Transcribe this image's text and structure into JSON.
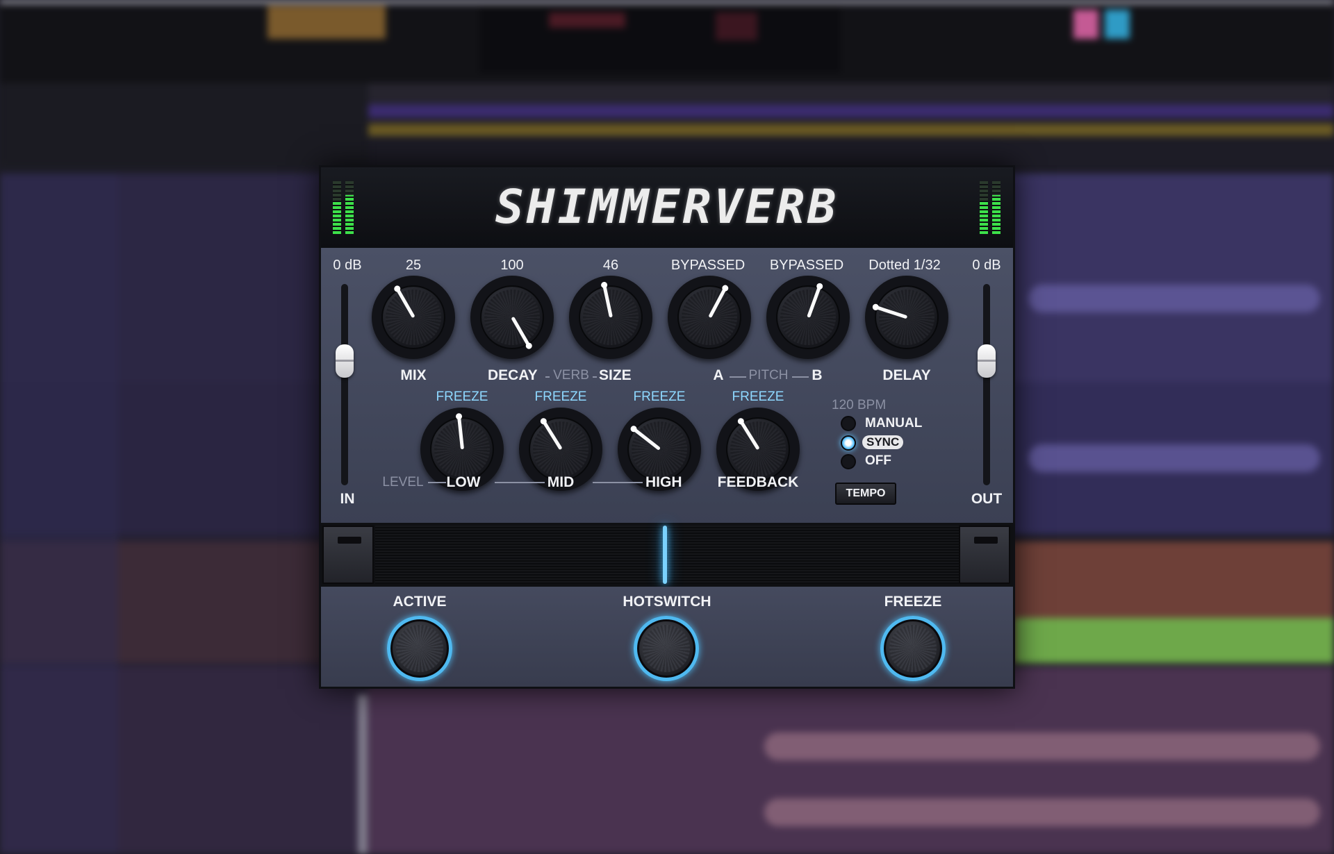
{
  "plugin": {
    "title": "SHIMMERVERB",
    "colors": {
      "accent": "#5fc4ff",
      "meter": "#3de04a",
      "panel": "#42475a"
    }
  },
  "input": {
    "value": "0 dB",
    "label": "IN",
    "level": 0.64
  },
  "output": {
    "value": "0 dB",
    "label": "OUT",
    "level": 0.64
  },
  "knobs_top": [
    {
      "label": "MIX",
      "value": "25"
    },
    {
      "label": "DECAY",
      "value": "100"
    },
    {
      "label": "SIZE",
      "value": "46"
    },
    {
      "label": "A",
      "value": "BYPASSED"
    },
    {
      "label": "B",
      "value": "BYPASSED"
    },
    {
      "label": "DELAY",
      "value": "Dotted 1/32"
    }
  ],
  "groups": {
    "verb": "VERB",
    "pitch": "PITCH",
    "level": "LEVEL"
  },
  "knobs_bottom": [
    {
      "label": "LOW",
      "value": "FREEZE"
    },
    {
      "label": "MID",
      "value": "FREEZE"
    },
    {
      "label": "HIGH",
      "value": "FREEZE"
    },
    {
      "label": "FEEDBACK",
      "value": "FREEZE"
    }
  ],
  "sync": {
    "bpm": "120 BPM",
    "options": [
      "MANUAL",
      "SYNC",
      "OFF"
    ],
    "selected": "SYNC",
    "tempo_button": "TEMPO"
  },
  "footswitches": [
    {
      "label": "ACTIVE",
      "icon": "footswitch-icon"
    },
    {
      "label": "HOTSWITCH",
      "icon": "footswitch-icon"
    },
    {
      "label": "FREEZE",
      "icon": "footswitch-icon"
    }
  ]
}
